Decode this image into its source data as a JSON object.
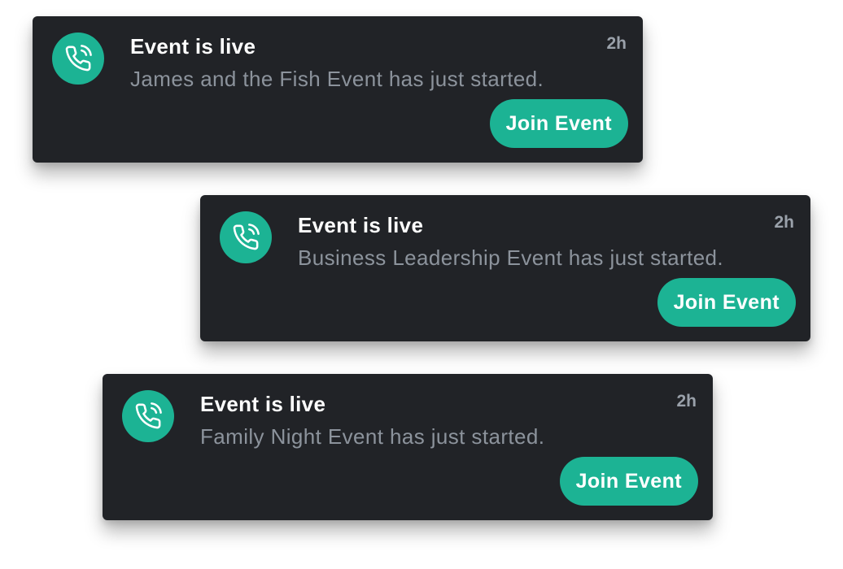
{
  "colors": {
    "card_background": "#212327",
    "accent": "#1cb394",
    "title_text": "#ffffff",
    "message_text": "#8c939c",
    "time_text": "#9aa1aa"
  },
  "notifications": [
    {
      "icon": "phone-call-icon",
      "title": "Event is live",
      "message": "James and the Fish Event has just started.",
      "time": "2h",
      "action_label": "Join Event"
    },
    {
      "icon": "phone-call-icon",
      "title": "Event is live",
      "message": "Business Leadership Event has just started.",
      "time": "2h",
      "action_label": "Join Event"
    },
    {
      "icon": "phone-call-icon",
      "title": "Event is live",
      "message": "Family Night Event has just started.",
      "time": "2h",
      "action_label": "Join Event"
    }
  ]
}
